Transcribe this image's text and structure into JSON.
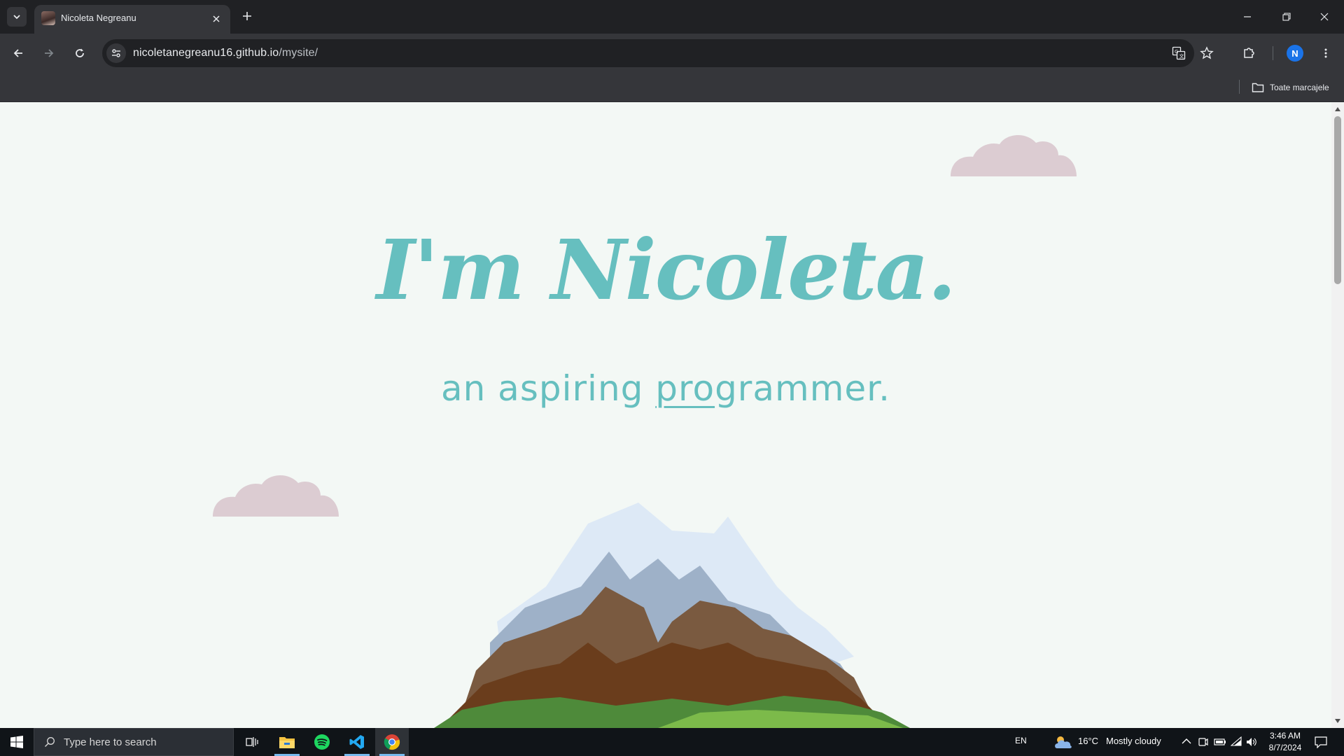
{
  "browser": {
    "tab_title": "Nicoleta Negreanu",
    "url_host": "nicoletanegreanu16.github.io",
    "url_path": "/mysite/",
    "profile_initial": "N",
    "bookmarks_all_label": "Toate marcajele"
  },
  "page": {
    "title": "I'm Nicoleta.",
    "subtitle_pre": "an aspiring ",
    "subtitle_underlined": "pro",
    "subtitle_post": "grammer.",
    "accent_color": "#66bfbf",
    "background_color": "#f3f8f5",
    "cloud_color": "#dcccd2"
  },
  "taskbar": {
    "search_placeholder": "Type here to search",
    "language": "EN",
    "weather_temp": "16°C",
    "weather_desc": "Mostly cloudy",
    "time": "3:46 AM",
    "date": "8/7/2024",
    "apps": [
      "task-view",
      "file-explorer",
      "spotify",
      "vs-code",
      "chrome"
    ]
  }
}
